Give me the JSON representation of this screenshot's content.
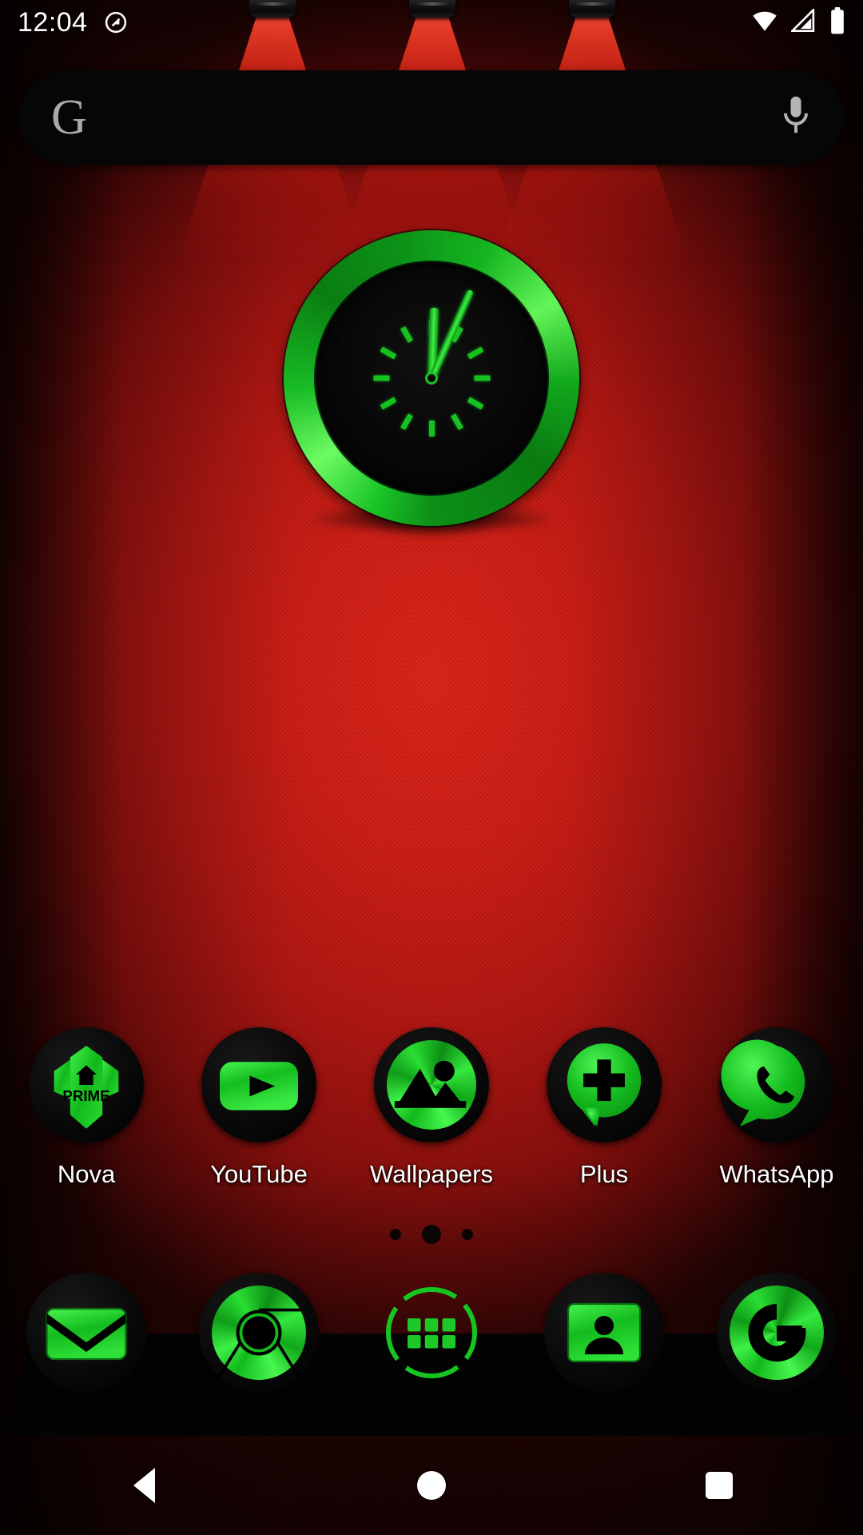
{
  "status_bar": {
    "time": "12:04",
    "rotation_lock_icon": "rotation-lock-icon",
    "wifi_icon": "wifi-icon",
    "signal_icon": "cell-signal-icon",
    "battery_icon": "battery-full-icon"
  },
  "search": {
    "logo": "google-g-logo",
    "logo_letter": "G",
    "placeholder": "",
    "value": "",
    "mic_icon": "microphone-icon"
  },
  "clock_widget": {
    "name": "analog-clock-widget",
    "hour": 12,
    "minute": 4,
    "hour_hand_deg": 2,
    "minute_hand_deg": 24,
    "bezel_color": "#16c21f",
    "face_color": "#000000",
    "tick_count": 12
  },
  "apps": [
    {
      "label": "Nova",
      "icon": "nova-prime-icon"
    },
    {
      "label": "YouTube",
      "icon": "youtube-icon"
    },
    {
      "label": "Wallpapers",
      "icon": "wallpapers-icon"
    },
    {
      "label": "Plus",
      "icon": "google-plus-icon"
    },
    {
      "label": "WhatsApp",
      "icon": "whatsapp-icon"
    }
  ],
  "page_indicator": {
    "total": 3,
    "active_index": 1
  },
  "dock": [
    {
      "label": "Gmail",
      "icon": "gmail-icon"
    },
    {
      "label": "Chrome",
      "icon": "chrome-icon"
    },
    {
      "label": "App Drawer",
      "icon": "app-drawer-icon"
    },
    {
      "label": "Contacts",
      "icon": "contacts-icon"
    },
    {
      "label": "Google",
      "icon": "google-icon"
    }
  ],
  "nav_bar": {
    "back": "back-button",
    "home": "home-button",
    "recents": "recents-button"
  },
  "theme": {
    "accent_green": "#16c21f",
    "wallpaper_red": "#d41f16",
    "dock_black": "#030303",
    "label_white": "#ffffff"
  }
}
